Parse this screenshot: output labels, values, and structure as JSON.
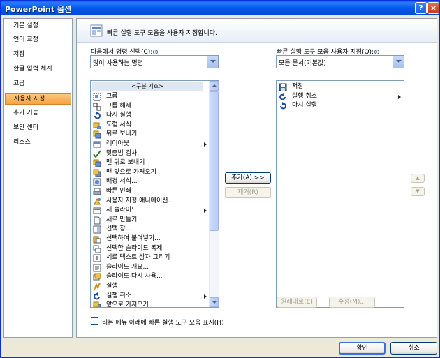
{
  "window": {
    "title": "PowerPoint 옵션",
    "help_label": "?",
    "close_label": "×"
  },
  "sidebar": {
    "items": [
      {
        "label": "기본 설정"
      },
      {
        "label": "언어 교정"
      },
      {
        "label": "저장"
      },
      {
        "label": "한글 입력 체계"
      },
      {
        "label": "고급"
      },
      {
        "label": "사용자 지정",
        "active": true
      },
      {
        "label": "추가 기능"
      },
      {
        "label": "보안 센터"
      },
      {
        "label": "리소스"
      }
    ]
  },
  "header": {
    "text": "빠른 실행 도구 모음을 사용자 지정합니다."
  },
  "left": {
    "label": "다음에서 명령 선택(C):",
    "combo_value": "많이 사용하는 명령",
    "separator": "<구분 기호>",
    "commands": [
      {
        "label": "그룹",
        "icon": "group-icon",
        "submenu": false
      },
      {
        "label": "그룹 해제",
        "icon": "ungroup-icon",
        "submenu": false
      },
      {
        "label": "다시 실행",
        "icon": "redo-icon",
        "submenu": false
      },
      {
        "label": "도형 서식",
        "icon": "format-shape-icon",
        "submenu": false
      },
      {
        "label": "뒤로 보내기",
        "icon": "send-backward-icon",
        "submenu": false
      },
      {
        "label": "레이아웃",
        "icon": "layout-icon",
        "submenu": true
      },
      {
        "label": "맞춤법 검사...",
        "icon": "spelling-icon",
        "submenu": false
      },
      {
        "label": "맨 뒤로 보내기",
        "icon": "send-to-back-icon",
        "submenu": false
      },
      {
        "label": "맨 앞으로 가져오기",
        "icon": "bring-to-front-icon",
        "submenu": false
      },
      {
        "label": "배경 서식...",
        "icon": "format-background-icon",
        "submenu": false
      },
      {
        "label": "빠른 인쇄",
        "icon": "quick-print-icon",
        "submenu": false
      },
      {
        "label": "사용자 지정 애니메이션...",
        "icon": "custom-animation-icon",
        "submenu": false
      },
      {
        "label": "새 슬라이드",
        "icon": "new-slide-icon",
        "submenu": true
      },
      {
        "label": "새로 만들기",
        "icon": "new-document-icon",
        "submenu": false
      },
      {
        "label": "선택 창...",
        "icon": "selection-pane-icon",
        "submenu": false
      },
      {
        "label": "선택하여 붙여넣기...",
        "icon": "paste-special-icon",
        "submenu": false
      },
      {
        "label": "선택한 슬라이드 복제",
        "icon": "duplicate-slide-icon",
        "submenu": false
      },
      {
        "label": "세로 텍스트 상자 그리기",
        "icon": "vertical-textbox-icon",
        "submenu": false
      },
      {
        "label": "슬라이드 개요...",
        "icon": "slide-outline-icon",
        "submenu": false
      },
      {
        "label": "슬라이드 다시 사용...",
        "icon": "reuse-slides-icon",
        "submenu": false
      },
      {
        "label": "실행",
        "icon": "action-icon",
        "submenu": false
      },
      {
        "label": "실행 취소",
        "icon": "undo-icon",
        "submenu": true
      },
      {
        "label": "앞으로 가져오기",
        "icon": "bring-forward-icon",
        "submenu": false
      }
    ]
  },
  "right": {
    "label": "빠른 실행 도구 모음 사용자 지정(Q):",
    "combo_value": "모든 문서(기본값)",
    "commands": [
      {
        "label": "저장",
        "icon": "save-icon",
        "submenu": false
      },
      {
        "label": "실행 취소",
        "icon": "undo-icon",
        "submenu": true
      },
      {
        "label": "다시 실행",
        "icon": "redo-icon",
        "submenu": false
      }
    ],
    "move_up_label": "▲",
    "move_down_label": "▼"
  },
  "buttons": {
    "add": "추가(A) >>",
    "remove": "제거(R)",
    "reset": "원래대로(E)",
    "modify": "수정(M)..."
  },
  "checkbox": {
    "label": "리본 메뉴 아래에 빠른 실행 도구 모음 표시(H)",
    "checked": false
  },
  "footer": {
    "ok": "확인",
    "cancel": "취소"
  }
}
